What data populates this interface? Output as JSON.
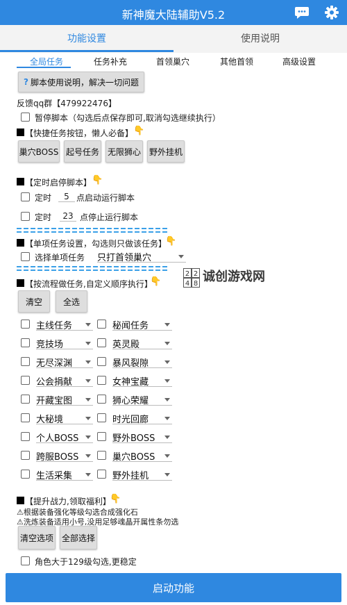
{
  "app": {
    "title": "新神魔大陆辅助V5.2"
  },
  "tabs": [
    "功能设置",
    "使用说明"
  ],
  "subtabs": [
    "全局任务",
    "任务补充",
    "首领巢穴",
    "其他首领",
    "高级设置"
  ],
  "help_button": "脚本使用说明，解决一切问题",
  "help_icon": "?",
  "qq_group": "反馈qq群【479922476】",
  "pause": "暂停脚本（勾选后点保存即可,取消勾选继续执行）",
  "quick_section": "【快捷任务按钮，懒人必备】",
  "quick_buttons": [
    "巢穴BOSS",
    "起号任务",
    "无限狮心",
    "野外挂机"
  ],
  "timer_section": "【定时启停脚本】",
  "timer_start": {
    "label": "定时",
    "value": "5",
    "suffix": "点启动运行脚本"
  },
  "timer_stop": {
    "label": "定时",
    "value": "23",
    "suffix": "点停止运行脚本"
  },
  "single_section": "【单项任务设置，勾选则只做该任务】",
  "single_label": "选择单项任务",
  "single_value": "只打首领巢穴",
  "flow_section": "【按流程做任务,自定义顺序执行】",
  "flow_clear": "清空",
  "flow_all": "全选",
  "flow_rows": [
    [
      "主线任务",
      "秘闻任务"
    ],
    [
      "竞技场",
      "英灵殿"
    ],
    [
      "无尽深渊",
      "暴风裂隙"
    ],
    [
      "公会捐献",
      "女神宝藏"
    ],
    [
      "开藏宝图",
      "狮心荣耀"
    ],
    [
      "大秘境",
      "时光回廊"
    ],
    [
      "个人BOSS",
      "野外BOSS"
    ],
    [
      "跨服BOSS",
      "巢穴BOSS"
    ],
    [
      "生活采集",
      "野外挂机"
    ]
  ],
  "power_section": "【提升战力,领取福利】",
  "warn1": "⚠根据装备强化等级勾选合成强化石",
  "warn2": "⚠洗炼装备适用小号,没用足够魂晶开属性条勿选",
  "power_clear": "清空选项",
  "power_all": "全部选择",
  "level_check": "角色大于129级勾选,更稳定",
  "start_button": "启动功能",
  "watermark": {
    "digits": [
      "2",
      "2",
      "4",
      "8"
    ],
    "text": "诚创游戏网"
  },
  "colors": {
    "primary": "#2f88e0",
    "hand": "#f0b400"
  },
  "icons": {
    "titlebar": [
      "chat-icon",
      "gear-icon"
    ],
    "section": "pointing-hand-icon"
  }
}
